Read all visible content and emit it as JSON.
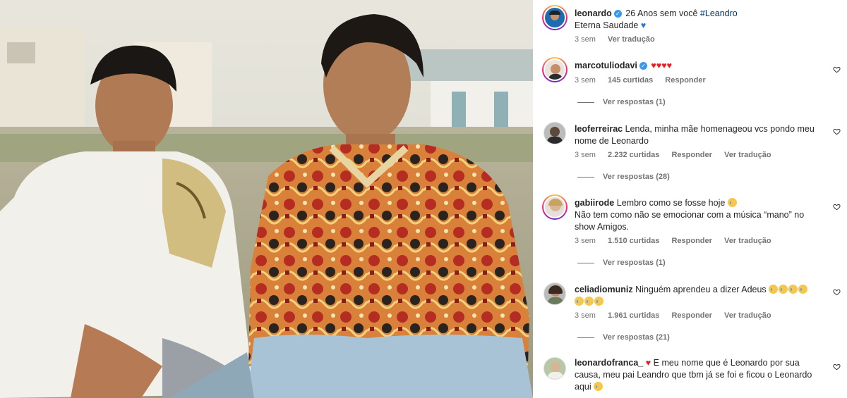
{
  "caption": {
    "username": "leonardo",
    "text": "26 Anos sem você",
    "hashtag": "#Leandro",
    "line2": "Eterna Saudade",
    "time": "3 sem",
    "translate": "Ver tradução"
  },
  "comments": [
    {
      "username": "marcotuliodavi",
      "verified": true,
      "text": "",
      "time": "3 sem",
      "likes": "145 curtidas",
      "reply": "Responder",
      "translate": "",
      "replies": "Ver respostas (1)"
    },
    {
      "username": "leoferreirac",
      "text": "Lenda, minha mãe homenageou vcs pondo meu nome de Leonardo",
      "time": "3 sem",
      "likes": "2.232 curtidas",
      "reply": "Responder",
      "translate": "Ver tradução",
      "replies": "Ver respostas (28)"
    },
    {
      "username": "gabiirode",
      "text_line1": "Lembro como se fosse hoje",
      "text_line2": "Não tem como não se emocionar com a música “mano” no show Amigos.",
      "time": "3 sem",
      "likes": "1.510 curtidas",
      "reply": "Responder",
      "translate": "Ver tradução",
      "replies": "Ver respostas (1)"
    },
    {
      "username": "celiadiomuniz",
      "text": "Ninguém aprendeu a dizer Adeus",
      "time": "3 sem",
      "likes": "1.961 curtidas",
      "reply": "Responder",
      "translate": "Ver tradução",
      "replies": "Ver respostas (21)"
    },
    {
      "username": "leonardofranca_",
      "text": "E meu nome que é Leonardo por sua causa, meu pai Leandro que tbm já se foi e ficou o Leonardo aqui"
    }
  ],
  "icons": {
    "like": "heart-outline-icon",
    "verified": "verified-badge-icon"
  }
}
